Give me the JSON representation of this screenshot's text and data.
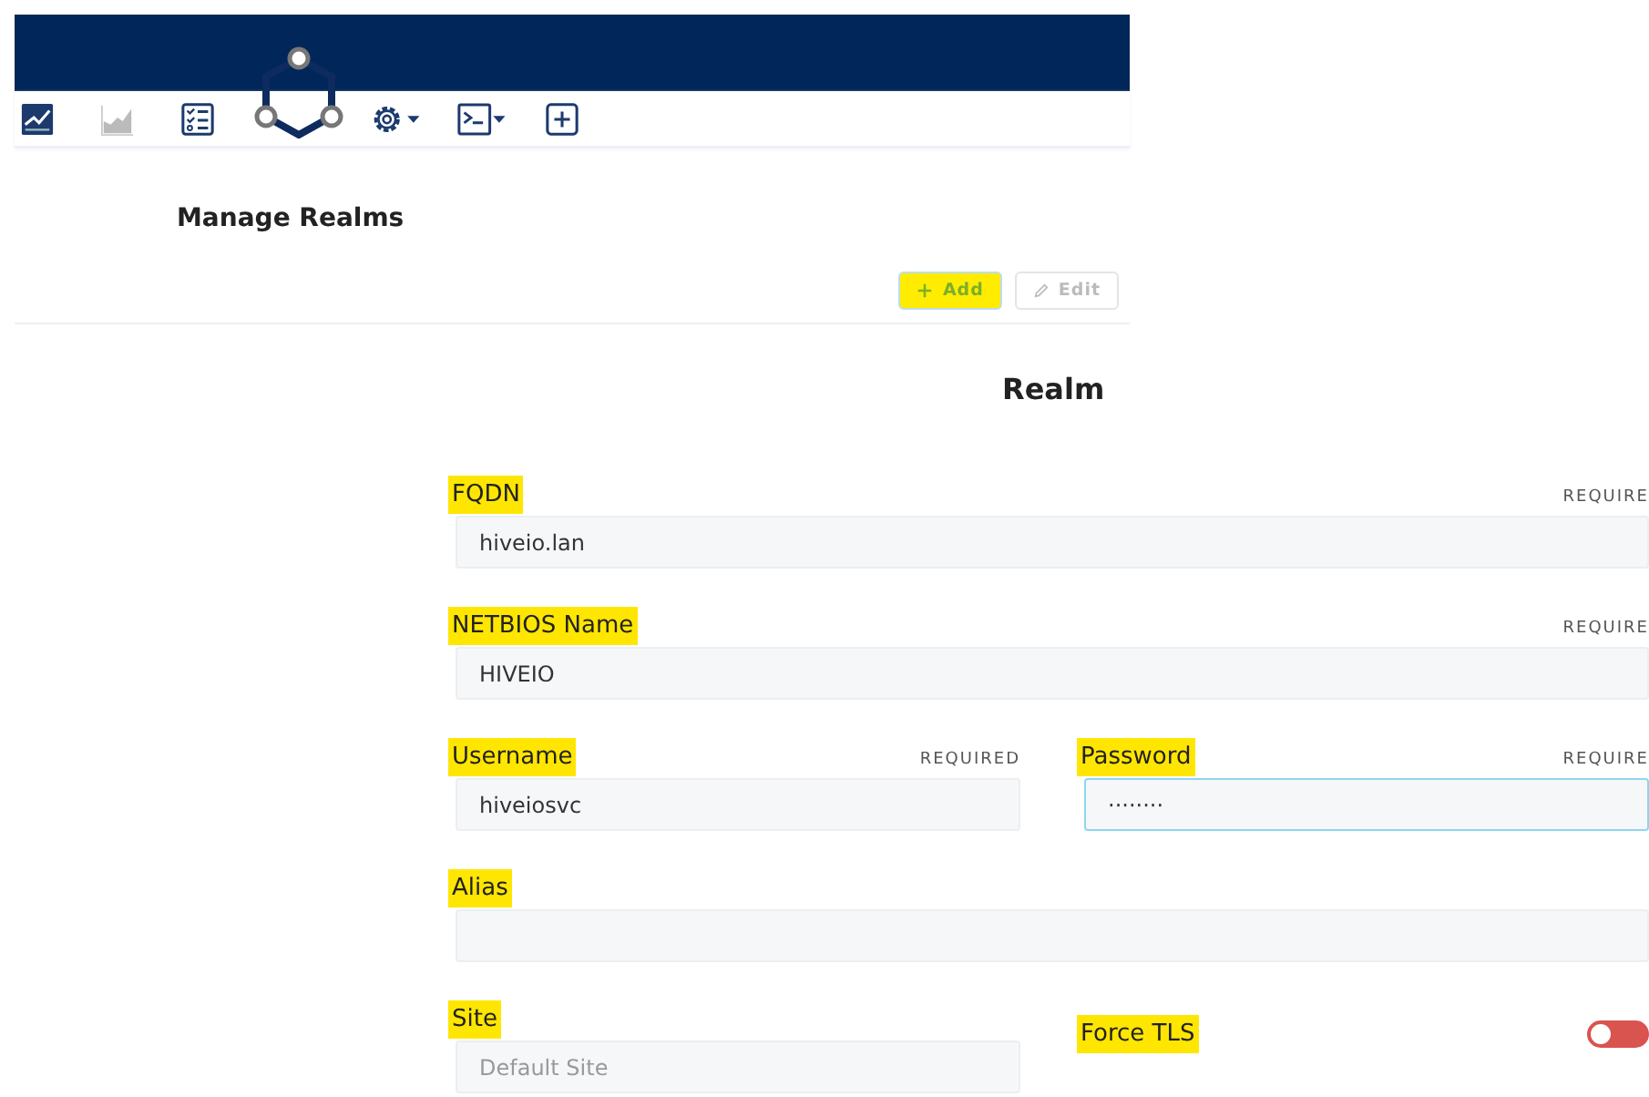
{
  "toolbar": [
    {
      "kind": "dashboard",
      "disabled": false
    },
    {
      "kind": "chart",
      "disabled": true
    },
    {
      "kind": "checklist",
      "disabled": false
    },
    {
      "kind": "logo",
      "disabled": false
    },
    {
      "kind": "gear",
      "disabled": false
    },
    {
      "kind": "terminal",
      "disabled": false
    },
    {
      "kind": "plus",
      "disabled": false
    }
  ],
  "page_title": "Manage Realms",
  "actions": [
    {
      "kind": "add",
      "label": "Add",
      "disabled": false,
      "highlighted": true
    },
    {
      "kind": "edit",
      "label": "Edit",
      "disabled": true,
      "highlighted": false
    }
  ],
  "form": {
    "title": "Realm",
    "rows": [
      [
        {
          "label": "FQDN",
          "highlighted": true,
          "required": "REQUIRE",
          "value": "hiveio.lan",
          "focused": false
        }
      ],
      [
        {
          "label": "NETBIOS Name",
          "highlighted": true,
          "required": "REQUIRE",
          "value": "HIVEIO",
          "focused": false
        }
      ],
      [
        {
          "label": "Username",
          "highlighted": true,
          "required": "REQUIRED",
          "value": "hiveiosvc",
          "focused": false
        },
        {
          "label": "Password",
          "highlighted": true,
          "required": "REQUIRE",
          "value": "········",
          "focused": true
        }
      ],
      [
        {
          "label": "Alias",
          "highlighted": true,
          "focused": false
        }
      ],
      [
        {
          "label": "Site",
          "highlighted": true,
          "placeholder": "Default Site",
          "focused": false
        },
        {
          "kind": "toggle",
          "label": "Force TLS",
          "highlighted": true,
          "on": false
        }
      ]
    ]
  }
}
